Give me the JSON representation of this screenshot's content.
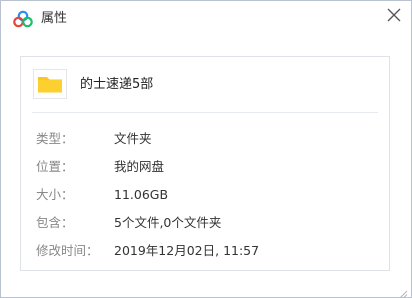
{
  "window": {
    "title": "属性",
    "app_icon": "baidu-netdisk-cloud-icon",
    "close_icon": "close-icon"
  },
  "item": {
    "icon": "folder-icon",
    "icon_color": "#f9c720",
    "name": "的士速递5部"
  },
  "properties": [
    {
      "label": "类型：",
      "value": "文件夹"
    },
    {
      "label": "位置：",
      "value": "我的网盘"
    },
    {
      "label": "大小：",
      "value": "11.06GB"
    },
    {
      "label": "包含：",
      "value": "5个文件,0个文件夹"
    },
    {
      "label": "修改时间：",
      "value": "2019年12月02日, 11:57"
    }
  ],
  "colors": {
    "label": "#888888",
    "value": "#333333",
    "border": "#b9c3cf",
    "cloud_blue": "#2d8cf0",
    "cloud_red": "#e8423f",
    "cloud_green": "#18c06a"
  }
}
